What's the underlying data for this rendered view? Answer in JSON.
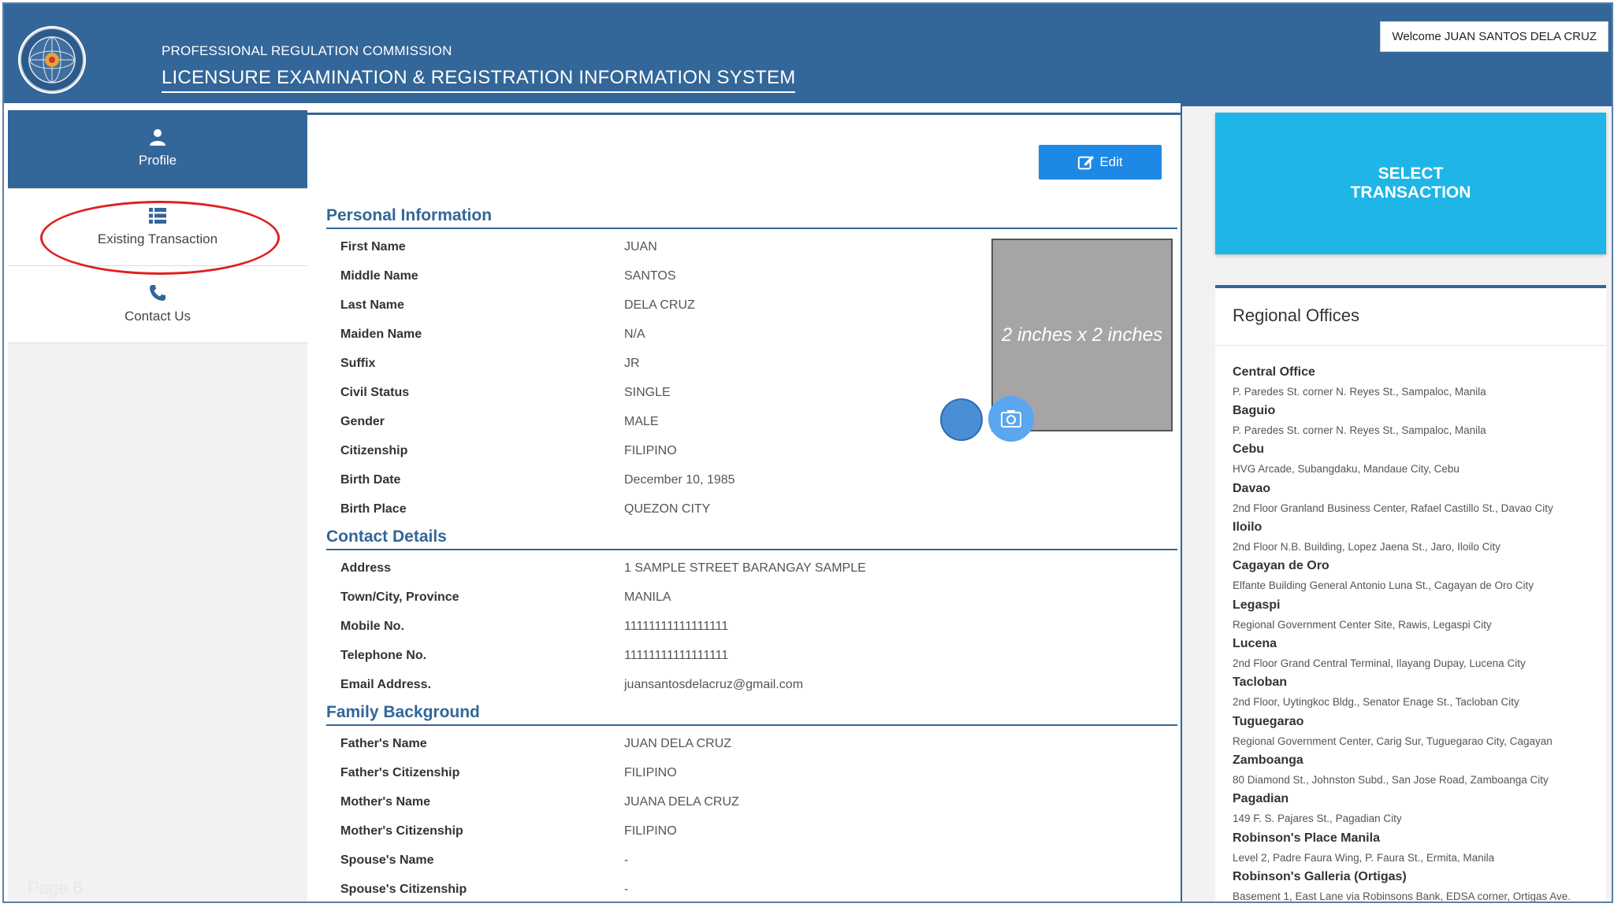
{
  "header": {
    "org": "PROFESSIONAL REGULATION COMMISSION",
    "system": "LICENSURE EXAMINATION & REGISTRATION INFORMATION SYSTEM",
    "welcome": "Welcome JUAN SANTOS DELA CRUZ"
  },
  "sidebar": {
    "items": [
      {
        "label": "Profile",
        "icon": "user-icon"
      },
      {
        "label": "Existing Transaction",
        "icon": "list-icon"
      },
      {
        "label": "Contact Us",
        "icon": "phone-icon"
      }
    ],
    "page_label": "Page 6"
  },
  "main": {
    "edit_label": "Edit",
    "photo_label": "2 inches x 2 inches",
    "personal": {
      "title": "Personal Information",
      "fields": [
        {
          "label": "First Name",
          "value": "JUAN"
        },
        {
          "label": "Middle Name",
          "value": "SANTOS"
        },
        {
          "label": "Last Name",
          "value": "DELA CRUZ"
        },
        {
          "label": "Maiden Name",
          "value": "N/A"
        },
        {
          "label": "Suffix",
          "value": "JR"
        },
        {
          "label": "Civil Status",
          "value": "SINGLE"
        },
        {
          "label": "Gender",
          "value": "MALE"
        },
        {
          "label": "Citizenship",
          "value": "FILIPINO"
        },
        {
          "label": "Birth Date",
          "value": "December 10, 1985"
        },
        {
          "label": "Birth Place",
          "value": "QUEZON CITY"
        }
      ]
    },
    "contact": {
      "title": "Contact Details",
      "fields": [
        {
          "label": "Address",
          "value": "1 SAMPLE STREET BARANGAY SAMPLE"
        },
        {
          "label": "Town/City, Province",
          "value": "MANILA"
        },
        {
          "label": "Mobile No.",
          "value": "11111111111111111"
        },
        {
          "label": "Telephone No.",
          "value": "11111111111111111"
        },
        {
          "label": "Email Address.",
          "value": "juansantosdelacruz@gmail.com"
        }
      ]
    },
    "family": {
      "title": "Family Background",
      "fields": [
        {
          "label": "Father's Name",
          "value": "JUAN DELA CRUZ"
        },
        {
          "label": "Father's Citizenship",
          "value": "FILIPINO"
        },
        {
          "label": "Mother's Name",
          "value": "JUANA DELA CRUZ"
        },
        {
          "label": "Mother's Citizenship",
          "value": "FILIPINO"
        },
        {
          "label": "Spouse's Name",
          "value": "-"
        },
        {
          "label": "Spouse's Citizenship",
          "value": "-"
        }
      ]
    }
  },
  "right": {
    "select_line1": "SELECT",
    "select_line2": "TRANSACTION",
    "regional_title": "Regional Offices",
    "offices": [
      {
        "name": "Central Office",
        "address": "P. Paredes St. corner N. Reyes St., Sampaloc, Manila"
      },
      {
        "name": "Baguio",
        "address": "P. Paredes St. corner N. Reyes St., Sampaloc, Manila"
      },
      {
        "name": "Cebu",
        "address": "HVG Arcade, Subangdaku, Mandaue City, Cebu"
      },
      {
        "name": "Davao",
        "address": "2nd Floor Granland Business Center, Rafael Castillo St., Davao City"
      },
      {
        "name": "Iloilo",
        "address": "2nd Floor N.B. Building, Lopez Jaena St., Jaro, Iloilo City"
      },
      {
        "name": "Cagayan de Oro",
        "address": "Elfante Building General Antonio Luna St., Cagayan de Oro City"
      },
      {
        "name": "Legaspi",
        "address": "Regional Government Center Site, Rawis, Legaspi City"
      },
      {
        "name": "Lucena",
        "address": "2nd Floor Grand Central Terminal, Ilayang Dupay, Lucena City"
      },
      {
        "name": "Tacloban",
        "address": "2nd Floor, Uytingkoc Bldg., Senator Enage St., Tacloban City"
      },
      {
        "name": "Tuguegarao",
        "address": "Regional Government Center, Carig Sur, Tuguegarao City, Cagayan"
      },
      {
        "name": "Zamboanga",
        "address": "80 Diamond St., Johnston Subd., San Jose Road, Zamboanga City"
      },
      {
        "name": "Pagadian",
        "address": "149 F. S. Pajares St., Pagadian City"
      },
      {
        "name": "Robinson's Place Manila",
        "address": "Level 2, Padre Faura Wing, P. Faura St., Ermita, Manila"
      },
      {
        "name": "Robinson's Galleria (Ortigas)",
        "address": "Basement 1, East Lane via Robinsons Bank, EDSA corner, Ortigas Ave."
      }
    ]
  }
}
